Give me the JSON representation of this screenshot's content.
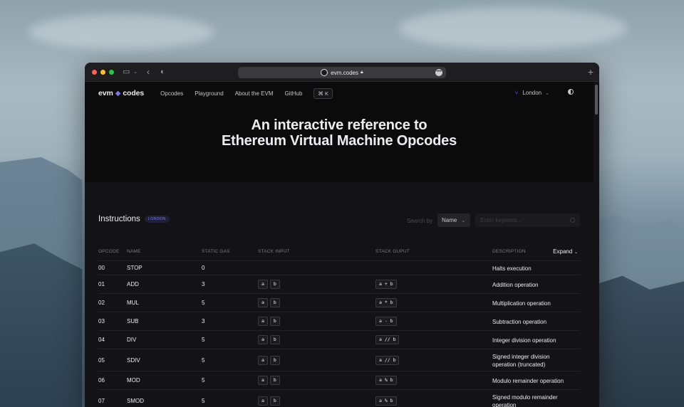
{
  "browser": {
    "url": "evm.codes",
    "new_tab_label": "+"
  },
  "nav": {
    "logo_left": "evm",
    "logo_right": "codes",
    "links": [
      "Opcodes",
      "Playground",
      "About the EVM",
      "GitHub"
    ],
    "shortcut": "⌘ K",
    "fork": "London"
  },
  "hero": {
    "line1": "An interactive reference to",
    "line2": "Ethereum Virtual Machine Opcodes"
  },
  "instructions": {
    "title": "Instructions",
    "badge": "LONDON",
    "search_label": "Search by",
    "search_by": "Name",
    "search_placeholder": "Enter keyword...",
    "expand_label": "Expand",
    "columns": [
      "OPCODE",
      "NAME",
      "STATIC GAS",
      "STACK INPUT",
      "STACK OUPUT",
      "DESCRIPTION"
    ],
    "rows": [
      {
        "opcode": "00",
        "name": "STOP",
        "gas": "0",
        "inputs": [],
        "output": "",
        "description": "Halts execution"
      },
      {
        "opcode": "01",
        "name": "ADD",
        "gas": "3",
        "inputs": [
          "a",
          "b"
        ],
        "output": "a + b",
        "description": "Addition operation"
      },
      {
        "opcode": "02",
        "name": "MUL",
        "gas": "5",
        "inputs": [
          "a",
          "b"
        ],
        "output": "a * b",
        "description": "Multiplication operation"
      },
      {
        "opcode": "03",
        "name": "SUB",
        "gas": "3",
        "inputs": [
          "a",
          "b"
        ],
        "output": "a - b",
        "description": "Subtraction operation"
      },
      {
        "opcode": "04",
        "name": "DIV",
        "gas": "5",
        "inputs": [
          "a",
          "b"
        ],
        "output": "a // b",
        "description": "Integer division operation"
      },
      {
        "opcode": "05",
        "name": "SDIV",
        "gas": "5",
        "inputs": [
          "a",
          "b"
        ],
        "output": "a // b",
        "description": "Signed integer division operation (truncated)"
      },
      {
        "opcode": "06",
        "name": "MOD",
        "gas": "5",
        "inputs": [
          "a",
          "b"
        ],
        "output": "a % b",
        "description": "Modulo remainder operation"
      },
      {
        "opcode": "07",
        "name": "SMOD",
        "gas": "5",
        "inputs": [
          "a",
          "b"
        ],
        "output": "a % b",
        "description": "Signed modulo remainder operation"
      }
    ]
  }
}
